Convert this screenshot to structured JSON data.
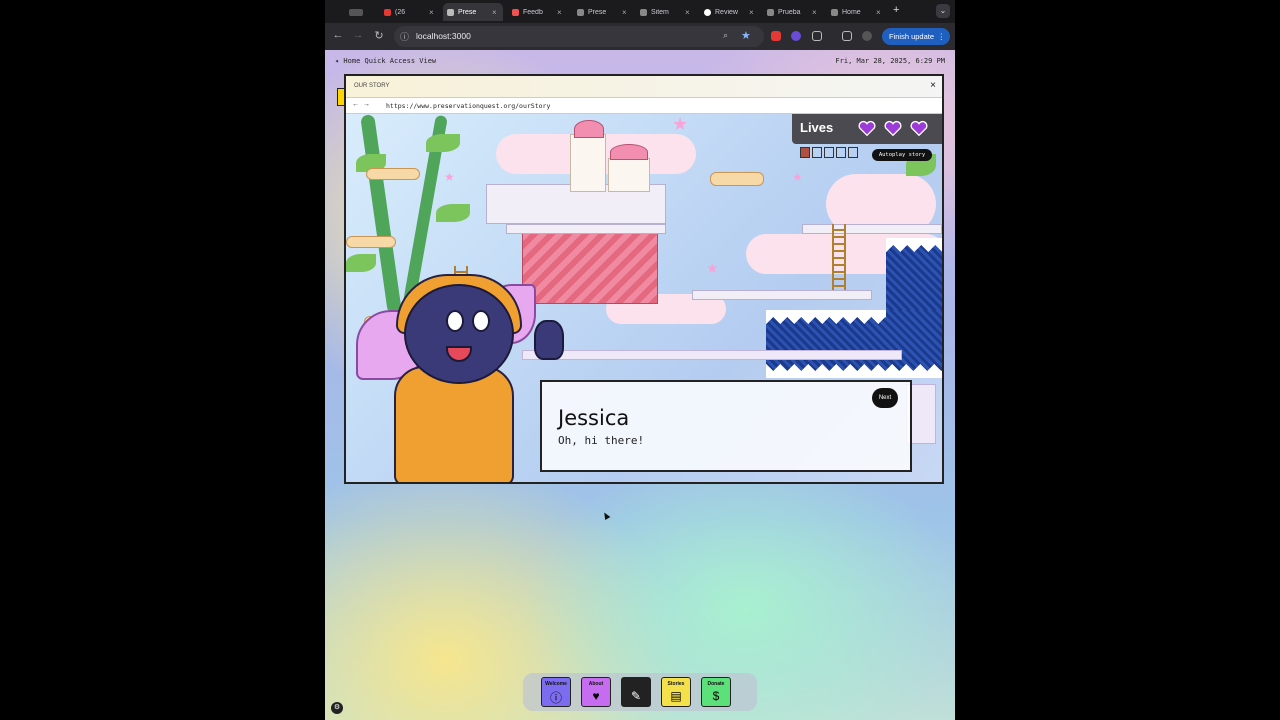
{
  "browser": {
    "tabs": [
      {
        "label": "(26",
        "color": "#e53935",
        "active": false
      },
      {
        "label": "Prese",
        "color": "#9e9e9e",
        "active": true
      },
      {
        "label": "Feedb",
        "color": "#ef5350",
        "active": false
      },
      {
        "label": "Prese",
        "color": "#9e9e9e",
        "active": false
      },
      {
        "label": "Sitem",
        "color": "#9e9e9e",
        "active": false
      },
      {
        "label": "Review",
        "color": "#9e9e9e",
        "active": false
      },
      {
        "label": "Prueba",
        "color": "#9e9e9e",
        "active": false
      },
      {
        "label": "Home",
        "color": "#9e9e9e",
        "active": false
      }
    ],
    "new_tab": "+",
    "url": "localhost:3000",
    "finish_update": "Finish update"
  },
  "menubar": {
    "left": "✦ Home Quick Access View",
    "right": "Fri, Mar 28, 2025, 6:29 PM"
  },
  "window": {
    "title": "OUR STORY",
    "close": "×",
    "url": "https://www.preservationquest.org/ourStory"
  },
  "game": {
    "lives_label": "Lives",
    "lives_count": 3,
    "heart_color": "#9c3bd8",
    "story_progress": {
      "completed": 1,
      "total": 5
    },
    "autoplay_label": "Autoplay story",
    "dialog": {
      "speaker": "Jessica",
      "line": "Oh, hi there!",
      "next_label": "Next"
    }
  },
  "dock": [
    {
      "label": "Welcome",
      "icon": "ⓘ",
      "bg": "#7b6cf0"
    },
    {
      "label": "About",
      "icon": "♥",
      "bg": "#c66cf0"
    },
    {
      "label": "",
      "icon": "✎",
      "bg": "#222222"
    },
    {
      "label": "Stories",
      "icon": "▤",
      "bg": "#f4e04a"
    },
    {
      "label": "Donate",
      "icon": "$",
      "bg": "#5ce07a"
    }
  ]
}
